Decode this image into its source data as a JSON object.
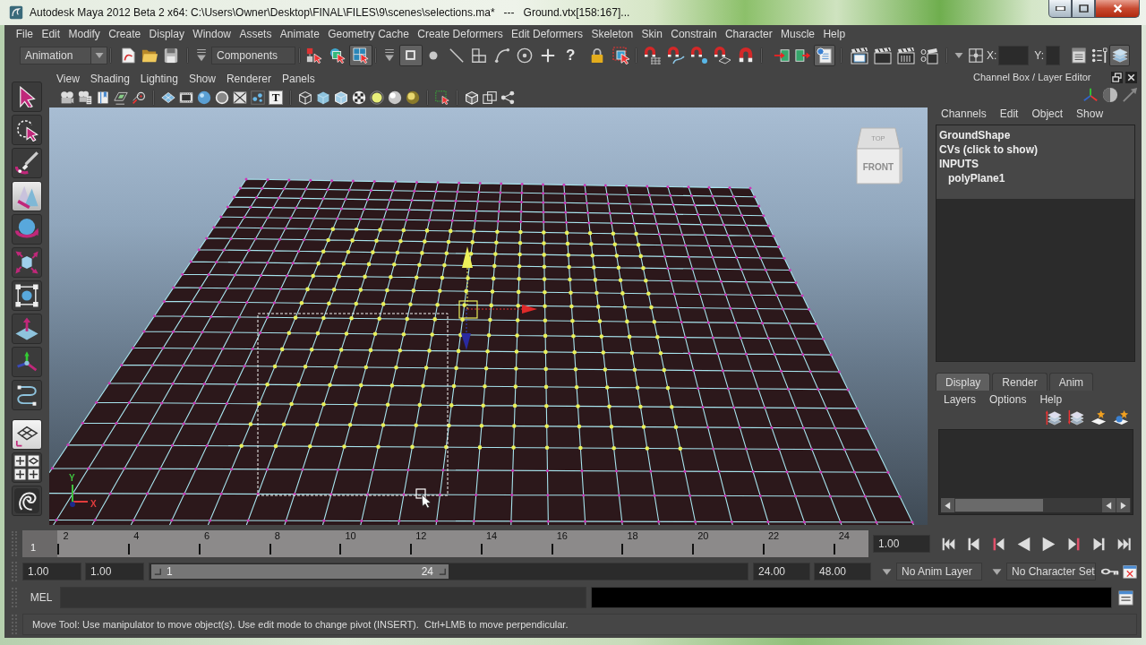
{
  "title_bar": {
    "title": "Autodesk Maya 2012 Beta 2 x64: C:\\Users\\Owner\\Desktop\\FINAL\\FILES\\9\\scenes\\selections.ma*   ---   Ground.vtx[158:167]..."
  },
  "menu_bar": [
    "File",
    "Edit",
    "Modify",
    "Create",
    "Display",
    "Window",
    "Assets",
    "Animate",
    "Geometry Cache",
    "Create Deformers",
    "Edit Deformers",
    "Skeleton",
    "Skin",
    "Constrain",
    "Character",
    "Muscle",
    "Help"
  ],
  "status_line": {
    "menu_set": "Animation",
    "file_tools": [
      {
        "kind": "new",
        "selected": false
      },
      {
        "kind": "open",
        "selected": false
      },
      {
        "kind": "save",
        "selected": false
      }
    ],
    "selection_mode": "Components",
    "mode_tools": [
      {
        "kind": "hierarchy",
        "selected": false
      },
      {
        "kind": "object",
        "selected": false
      },
      {
        "kind": "component",
        "selected": true
      }
    ],
    "mask_tools": [
      {
        "kind": "point",
        "selected": true
      },
      {
        "kind": "dot",
        "selected": false
      },
      {
        "kind": "line",
        "selected": false
      },
      {
        "kind": "blocks",
        "selected": false
      },
      {
        "kind": "curve",
        "selected": false
      },
      {
        "kind": "target",
        "selected": false
      },
      {
        "kind": "plus",
        "selected": false
      },
      {
        "kind": "help",
        "glyph": "?",
        "selected": false
      }
    ],
    "lock_tools": [
      {
        "kind": "lock",
        "selected": false
      },
      {
        "kind": "marquee",
        "selected": false
      }
    ],
    "snap_tools": [
      {
        "kind": "snapgrid",
        "selected": false
      },
      {
        "kind": "snapcurve",
        "selected": false
      },
      {
        "kind": "snappoint",
        "selected": false
      },
      {
        "kind": "snapplane",
        "selected": false
      },
      {
        "kind": "snapmagnet",
        "selected": false
      }
    ],
    "history_tools": [
      {
        "kind": "input",
        "selected": false
      },
      {
        "kind": "output",
        "selected": false
      },
      {
        "kind": "history",
        "selected": true
      }
    ],
    "render_tools": [
      {
        "kind": "render",
        "selected": false
      },
      {
        "kind": "clapper",
        "selected": false
      },
      {
        "kind": "ipr",
        "selected": false
      },
      {
        "kind": "rendersettings",
        "selected": false
      }
    ],
    "coordinate_fields": [
      {
        "label": "X:"
      },
      {
        "label": "Y:"
      }
    ],
    "panel_tools": [
      {
        "kind": "attributes",
        "selected": false
      },
      {
        "kind": "toolsettings",
        "selected": false
      },
      {
        "kind": "channelbox",
        "selected": true
      }
    ]
  },
  "toolbox": {
    "tools": [
      {
        "kind": "select",
        "selected": false
      },
      {
        "kind": "lasso",
        "selected": false
      },
      {
        "kind": "paint",
        "selected": false
      },
      {
        "kind": "move",
        "selected": true
      },
      {
        "kind": "rotate",
        "selected": false
      },
      {
        "kind": "scale",
        "selected": false
      },
      {
        "kind": "universal",
        "selected": false
      },
      {
        "kind": "softmod",
        "selected": false
      },
      {
        "kind": "manip",
        "selected": false
      },
      {
        "kind": "lasttool",
        "selected": false
      }
    ]
  },
  "viewport": {
    "menu": [
      "View",
      "Shading",
      "Lighting",
      "Show",
      "Renderer",
      "Panels"
    ],
    "hud_glyph": "T",
    "view_cube": {
      "top": "TOP",
      "front": "FRONT"
    },
    "axis_labels": [
      {
        "text": "Y",
        "color": "#3fc23f"
      },
      {
        "text": "X",
        "color": "#e23c3c"
      }
    ]
  },
  "channel_box": {
    "title": "Channel Box / Layer Editor",
    "menu": [
      "Channels",
      "Edit",
      "Object",
      "Show"
    ],
    "nodes": [
      {
        "text": "GroundShape"
      },
      {
        "text": "CVs (click to show)"
      },
      {
        "text": "INPUTS",
        "children": [
          {
            "text": "polyPlane1"
          }
        ]
      }
    ]
  },
  "layer_editor": {
    "tabs": [
      {
        "label": "Display",
        "selected": true
      },
      {
        "label": "Render",
        "selected": false
      },
      {
        "label": "Anim",
        "selected": false
      }
    ],
    "menu": [
      "Layers",
      "Options",
      "Help"
    ]
  },
  "time_slider": {
    "level": 0,
    "current_frame": "1",
    "frame_labels": [
      "2",
      "4",
      "6",
      "8",
      "10",
      "12",
      "14",
      "16",
      "18",
      "20",
      "22",
      "24"
    ],
    "current_time": "1.00"
  },
  "range_slider": {
    "start_time": "1.00",
    "playback_start": "1.00",
    "handle_start": "1",
    "handle_end": "24",
    "level": 0.5,
    "playback_end": "24.00",
    "end_time": "48.00",
    "anim_layer": "No Anim Layer",
    "character_set": "No Character Set"
  },
  "command_line": {
    "language": "MEL"
  },
  "help_line": {
    "text": "Move Tool: Use manipulator to move object(s). Use edit mode to change pivot (INSERT).  Ctrl+LMB to move perpendicular."
  }
}
